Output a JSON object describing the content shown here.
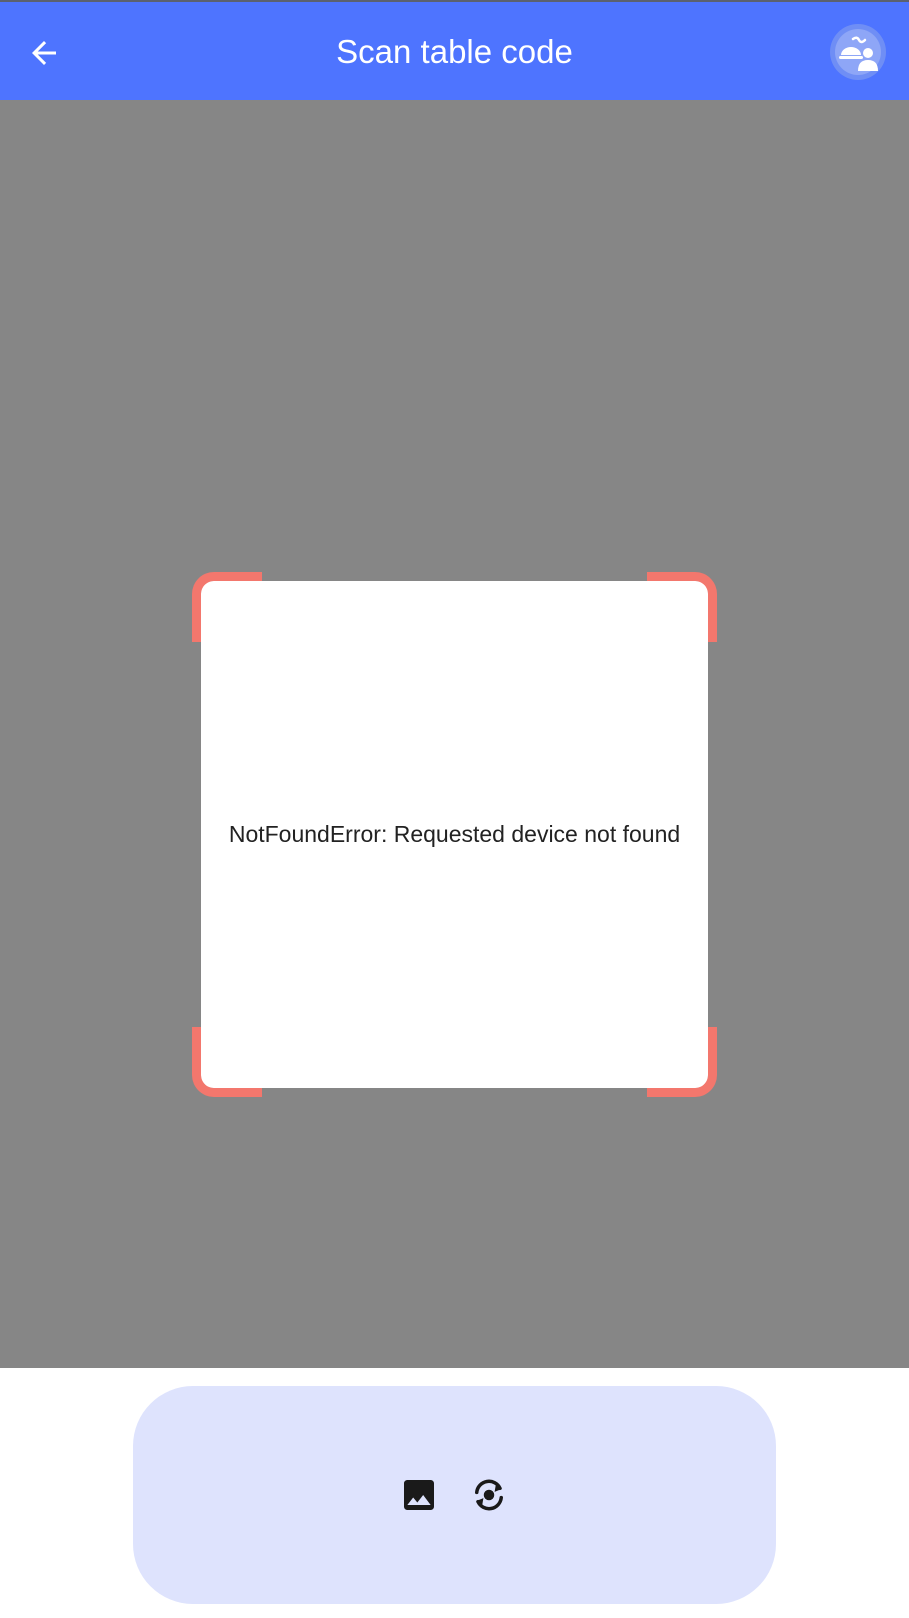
{
  "app_bar": {
    "title": "Scan table code",
    "back_icon": "arrow-back-icon",
    "avatar_icon": "waiter-avatar-icon",
    "background_color": "#4e74ff"
  },
  "scanner": {
    "error_message": "NotFoundError: Requested device not found",
    "corner_color": "#f3776d",
    "camera_background_color": "#868686"
  },
  "controls": {
    "gallery_icon": "image-gallery-icon",
    "switch_camera_icon": "switch-camera-icon",
    "panel_color": "#dee3fd"
  }
}
